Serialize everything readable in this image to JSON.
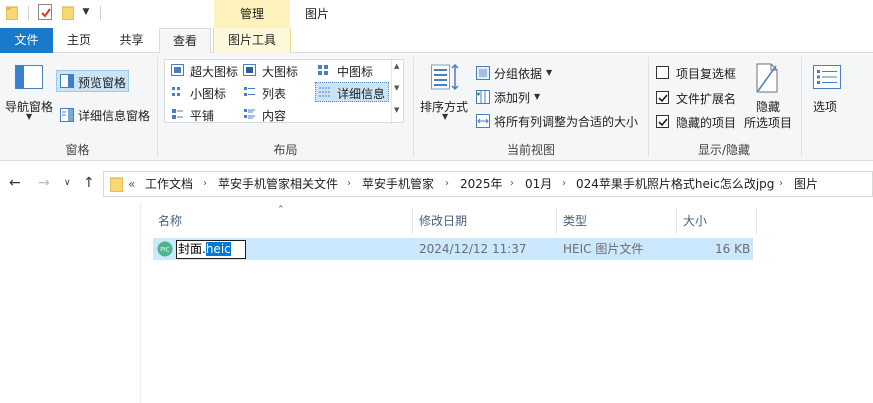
{
  "titlebar": {
    "manage_tab": "管理",
    "window_title": "图片"
  },
  "tabs": {
    "file": "文件",
    "home": "主页",
    "share": "共享",
    "view": "查看",
    "picture_tools": "图片工具"
  },
  "ribbon": {
    "panes": {
      "nav_pane": "导航窗格",
      "preview_pane": "预览窗格",
      "details_pane": "详细信息窗格",
      "group_label": "窗格"
    },
    "layout": {
      "extra_large_icons": "超大图标",
      "large_icons": "大图标",
      "medium_icons": "中图标",
      "small_icons": "小图标",
      "list": "列表",
      "details": "详细信息",
      "tiles": "平铺",
      "content": "内容",
      "group_label": "布局"
    },
    "current_view": {
      "sort_by": "排序方式",
      "group_by": "分组依据",
      "add_columns": "添加列",
      "size_columns": "将所有列调整为合适的大小",
      "group_label": "当前视图"
    },
    "show_hide": {
      "item_checkboxes": "项目复选框",
      "item_checkboxes_checked": false,
      "file_extensions": "文件扩展名",
      "file_extensions_checked": true,
      "hidden_items": "隐藏的项目",
      "hidden_items_checked": true,
      "hide_selected_line1": "隐藏",
      "hide_selected_line2": "所选项目",
      "group_label": "显示/隐藏"
    },
    "options": "选项"
  },
  "address": {
    "overflow": "«",
    "crumbs": [
      "工作文档",
      "苹安手机管家相关文件",
      "苹安手机管家",
      "2025年",
      "01月",
      "024苹果手机照片格式heic怎么改jpg",
      "图片"
    ]
  },
  "columns": {
    "name": "名称",
    "date_modified": "修改日期",
    "type": "类型",
    "size": "大小"
  },
  "files": [
    {
      "name_base": "封面.",
      "name_ext": "heic",
      "date_modified": "2024/12/12 11:37",
      "type": "HEIC 图片文件",
      "size": "16 KB",
      "icon": "pic-file-icon"
    }
  ],
  "colors": {
    "accent": "#1979ca",
    "selection": "#cce8ff",
    "manage_tab": "#fdf2bd"
  }
}
